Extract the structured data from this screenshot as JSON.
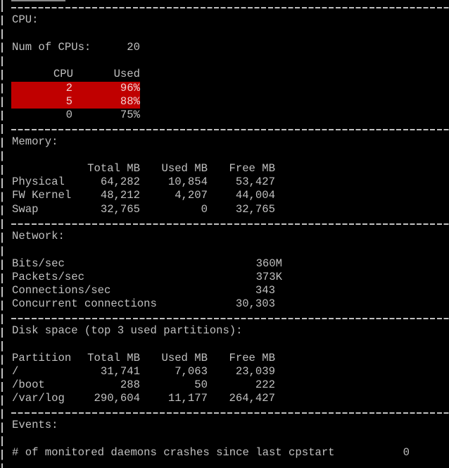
{
  "colors": {
    "background": "#000000",
    "text": "#c0c0c0",
    "alert_row": "#c00000"
  },
  "cpu": {
    "title": "CPU:",
    "num_label": "Num of CPUs:",
    "num_value": "20",
    "headers": [
      "CPU",
      "Used"
    ],
    "rows": [
      {
        "cpu": "2",
        "used": "96%",
        "alert": true
      },
      {
        "cpu": "5",
        "used": "88%",
        "alert": true
      },
      {
        "cpu": "0",
        "used": "75%",
        "alert": false
      }
    ]
  },
  "memory": {
    "title": "Memory:",
    "headers": [
      "",
      "Total MB",
      "Used MB",
      "Free MB"
    ],
    "rows": [
      {
        "name": "Physical",
        "total": "64,282",
        "used": "10,854",
        "free": "53,427"
      },
      {
        "name": "FW Kernel",
        "total": "48,212",
        "used": "4,207",
        "free": "44,004"
      },
      {
        "name": "Swap",
        "total": "32,765",
        "used": "0",
        "free": "32,765"
      }
    ]
  },
  "network": {
    "title": "Network:",
    "rows": [
      {
        "label": "Bits/sec",
        "value": "360M"
      },
      {
        "label": "Packets/sec",
        "value": "373K"
      },
      {
        "label": "Connections/sec",
        "value": "343"
      },
      {
        "label": "Concurrent connections",
        "value": "30,303"
      }
    ]
  },
  "disk": {
    "title": "Disk space (top 3 used partitions):",
    "headers": [
      "Partition",
      "Total MB",
      "Used MB",
      "Free MB"
    ],
    "rows": [
      {
        "name": "/",
        "total": "31,741",
        "used": "7,063",
        "free": "23,039"
      },
      {
        "name": "/boot",
        "total": "288",
        "used": "50",
        "free": "222"
      },
      {
        "name": "/var/log",
        "total": "290,604",
        "used": "11,177",
        "free": "264,427"
      }
    ]
  },
  "events": {
    "title": "Events:",
    "rows": [
      {
        "label": "# of monitored daemons crashes since last cpstart",
        "value": "0"
      }
    ]
  }
}
